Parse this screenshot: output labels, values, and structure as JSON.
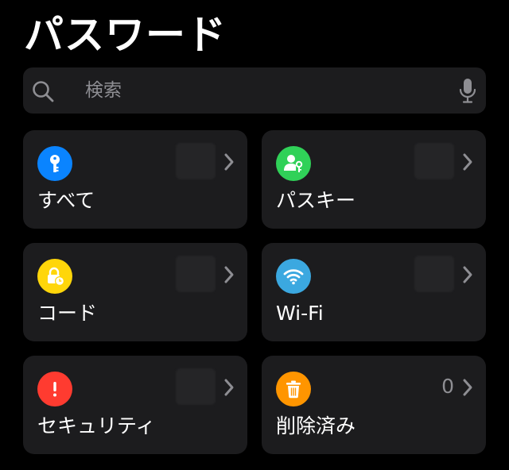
{
  "page_title": "パスワード",
  "search": {
    "placeholder": "検索",
    "search_icon": "magnifying-glass-icon",
    "mic_icon": "microphone-icon"
  },
  "colors": {
    "background": "#000000",
    "card": "#1c1c1e",
    "secondary_text": "#8e8e93",
    "blue": "#0a84ff",
    "green": "#30d158",
    "yellow": "#ffd60a",
    "light_blue": "#3ba8e0",
    "red": "#ff3b30",
    "orange": "#ff9500"
  },
  "categories": [
    {
      "label": "すべて",
      "icon": "key-icon",
      "color": "#0a84ff",
      "count": ""
    },
    {
      "label": "パスキー",
      "icon": "person-key-icon",
      "color": "#30d158",
      "count": ""
    },
    {
      "label": "コード",
      "icon": "lock-clock-icon",
      "color": "#ffd60a",
      "count": ""
    },
    {
      "label": "Wi-Fi",
      "icon": "wifi-icon",
      "color": "#3ba8e0",
      "count": ""
    },
    {
      "label": "セキュリティ",
      "icon": "exclamation-icon",
      "color": "#ff3b30",
      "count": ""
    },
    {
      "label": "削除済み",
      "icon": "trash-icon",
      "color": "#ff9500",
      "count": "0"
    }
  ]
}
